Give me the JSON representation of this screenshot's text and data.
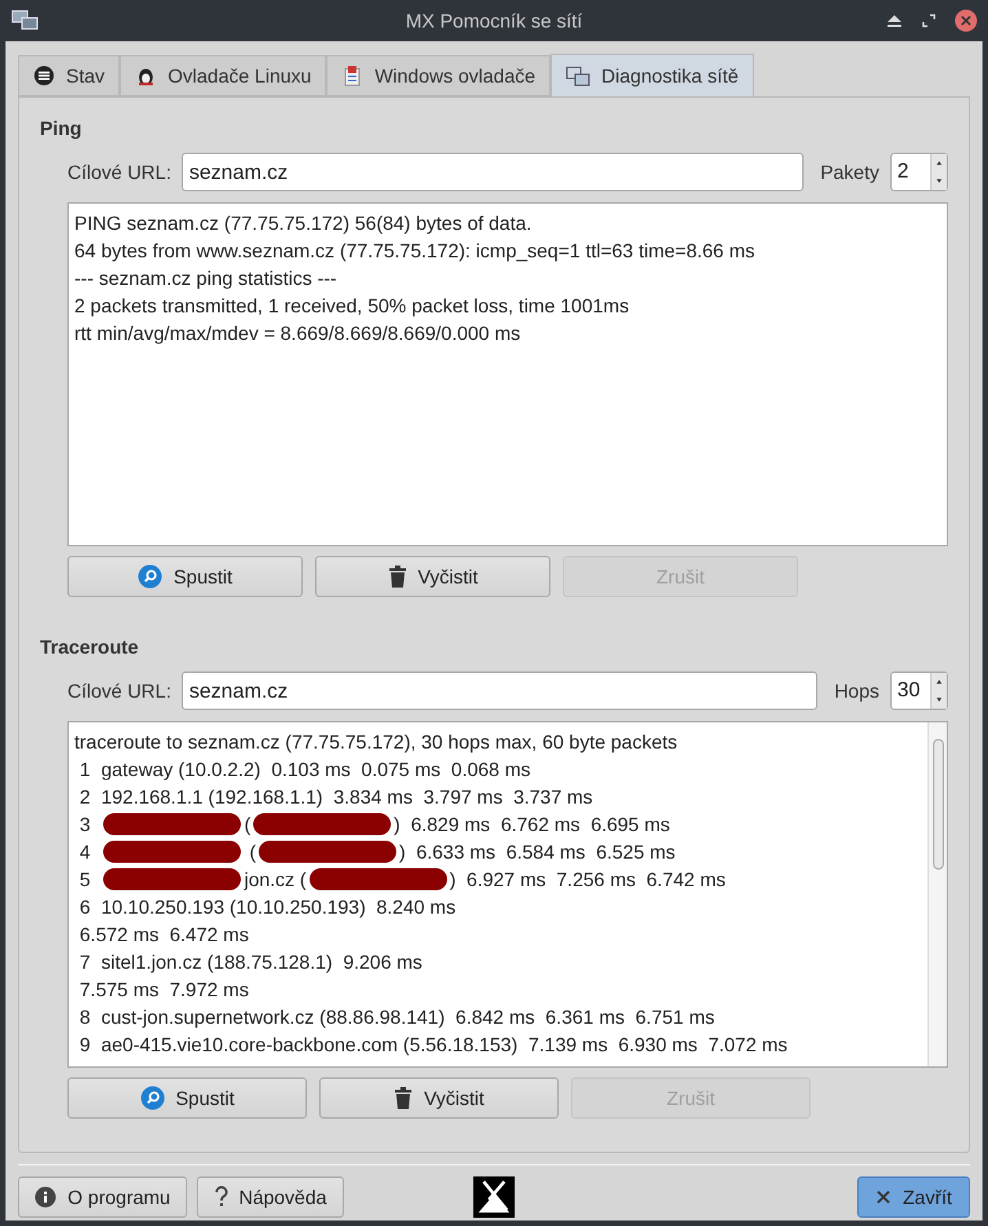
{
  "window": {
    "title": "MX Pomocník se sítí"
  },
  "tabs": [
    {
      "label": "Stav",
      "kind": "status",
      "selected": false
    },
    {
      "label": "Ovladače Linuxu",
      "kind": "linux",
      "selected": false
    },
    {
      "label": "Windows ovladače",
      "kind": "windows",
      "selected": false
    },
    {
      "label": "Diagnostika sítě",
      "kind": "network",
      "selected": true
    }
  ],
  "ping": {
    "title": "Ping",
    "url_label": "Cílové URL:",
    "url": "seznam.cz",
    "count_label": "Pakety",
    "count": "2",
    "output": [
      "PING seznam.cz (77.75.75.172) 56(84) bytes of data.",
      "64 bytes from www.seznam.cz (77.75.75.172): icmp_seq=1 ttl=63 time=8.66 ms",
      "--- seznam.cz ping statistics ---",
      "2 packets transmitted, 1 received, 50% packet loss, time 1001ms",
      "rtt min/avg/max/mdev = 8.669/8.669/8.669/0.000 ms"
    ],
    "buttons": [
      {
        "label": "Spustit",
        "kind": "start",
        "disabled": false
      },
      {
        "label": "Vyčistit",
        "kind": "clear",
        "disabled": false
      },
      {
        "label": "Zrušit",
        "kind": "cancel",
        "disabled": true
      }
    ]
  },
  "traceroute": {
    "title": "Traceroute",
    "url_label": "Cílové URL:",
    "url": "seznam.cz",
    "count_label": "Hops",
    "count": "30",
    "output": [
      [
        {
          "kind": "text",
          "text": "traceroute to seznam.cz (77.75.75.172), 30 hops max, 60 byte packets"
        }
      ],
      [
        {
          "kind": "text",
          "text": " 1  gateway (10.0.2.2)  0.103 ms  0.075 ms  0.068 ms"
        }
      ],
      [
        {
          "kind": "text",
          "text": " 2  192.168.1.1 (192.168.1.1)  3.834 ms  3.797 ms  3.737 ms"
        }
      ],
      [
        {
          "kind": "text",
          "text": " 3  "
        },
        {
          "kind": "redacted"
        },
        {
          "kind": "text",
          "text": "("
        },
        {
          "kind": "redacted"
        },
        {
          "kind": "text",
          "text": ")  6.829 ms  6.762 ms  6.695 ms"
        }
      ],
      [
        {
          "kind": "text",
          "text": " 4  "
        },
        {
          "kind": "redacted"
        },
        {
          "kind": "text",
          "text": " ("
        },
        {
          "kind": "redacted"
        },
        {
          "kind": "text",
          "text": ")  6.633 ms  6.584 ms  6.525 ms"
        }
      ],
      [
        {
          "kind": "text",
          "text": " 5  "
        },
        {
          "kind": "redacted"
        },
        {
          "kind": "text",
          "text": "jon.cz ("
        },
        {
          "kind": "redacted"
        },
        {
          "kind": "text",
          "text": ")  6.927 ms  7.256 ms  6.742 ms"
        }
      ],
      [
        {
          "kind": "text",
          "text": " 6  10.10.250.193 (10.10.250.193)  8.240 ms"
        }
      ],
      [
        {
          "kind": "text",
          "text": " 6.572 ms  6.472 ms"
        }
      ],
      [
        {
          "kind": "text",
          "text": " 7  sitel1.jon.cz (188.75.128.1)  9.206 ms"
        }
      ],
      [
        {
          "kind": "text",
          "text": " 7.575 ms  7.972 ms"
        }
      ],
      [
        {
          "kind": "text",
          "text": " 8  cust-jon.supernetwork.cz (88.86.98.141)  6.842 ms  6.361 ms  6.751 ms"
        }
      ],
      [
        {
          "kind": "text",
          "text": " 9  ae0-415.vie10.core-backbone.com (5.56.18.153)  7.139 ms  6.930 ms  7.072 ms"
        }
      ]
    ],
    "buttons": [
      {
        "label": "Spustit",
        "kind": "start",
        "disabled": false
      },
      {
        "label": "Vyčistit",
        "kind": "clear",
        "disabled": false
      },
      {
        "label": "Zrušit",
        "kind": "cancel",
        "disabled": true
      }
    ]
  },
  "footer": {
    "buttons": [
      {
        "label": "O programu",
        "kind": "about",
        "selected": false
      },
      {
        "label": "Nápověda",
        "kind": "help",
        "selected": false
      },
      {
        "label": "Zavřít",
        "kind": "close",
        "selected": true
      }
    ]
  }
}
